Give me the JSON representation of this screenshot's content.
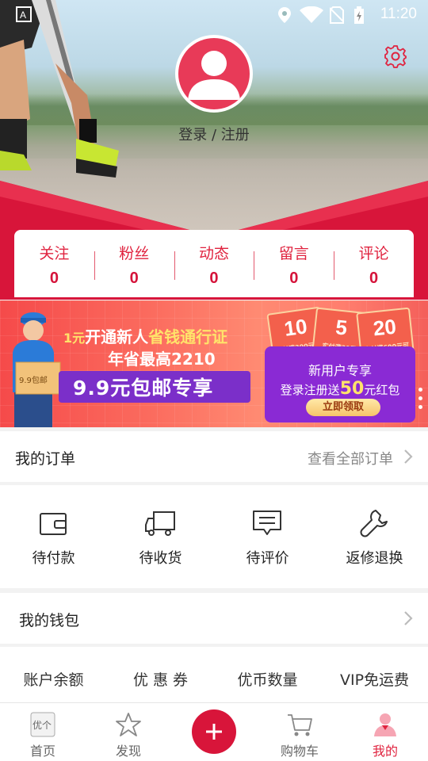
{
  "status_bar": {
    "time": "11:20",
    "icons": [
      "a-icon",
      "location-icon",
      "wifi-icon",
      "no-sim-icon",
      "battery-icon"
    ]
  },
  "profile": {
    "login_text": "登录 / 注册",
    "avatar_icon": "user-avatar-icon",
    "settings_icon": "gear-icon"
  },
  "stats": [
    {
      "label": "关注",
      "value": "0"
    },
    {
      "label": "粉丝",
      "value": "0"
    },
    {
      "label": "动态",
      "value": "0"
    },
    {
      "label": "留言",
      "value": "0"
    },
    {
      "label": "评论",
      "value": "0"
    }
  ],
  "promo": {
    "line1_prefix": "1元",
    "line1_mid": "开通新人",
    "line1_highlight": "省钱通行证",
    "line2": "年省最高2210",
    "pill": "9.9元包邮专享",
    "box_label": "9.9包邮",
    "vouchers": [
      {
        "amount": "10",
        "caption": "实付满300元可用"
      },
      {
        "amount": "5",
        "caption": "实付满39元"
      },
      {
        "amount": "20",
        "caption": "实付满600元可用"
      }
    ],
    "voucher_title": "新用户专享",
    "voucher_sub_prefix": "登录注册送",
    "voucher_sub_amount": "50",
    "voucher_sub_suffix": "元红包",
    "voucher_button": "立即领取"
  },
  "orders": {
    "title": "我的订单",
    "link": "查看全部订单",
    "items": [
      {
        "label": "待付款",
        "icon": "wallet-icon"
      },
      {
        "label": "待收货",
        "icon": "truck-icon"
      },
      {
        "label": "待评价",
        "icon": "comment-icon"
      },
      {
        "label": "返修退换",
        "icon": "wrench-icon"
      }
    ]
  },
  "wallet": {
    "title": "我的钱包",
    "items": [
      "账户余额",
      "优 惠 券",
      "优币数量",
      "VIP免运费"
    ]
  },
  "bottom_nav": [
    {
      "label": "首页",
      "icon": "home-logo-icon"
    },
    {
      "label": "发现",
      "icon": "star-icon"
    },
    {
      "label": "",
      "icon": "plus-icon"
    },
    {
      "label": "购物车",
      "icon": "cart-icon"
    },
    {
      "label": "我的",
      "icon": "profile-icon"
    }
  ],
  "home_logo_text": "优个",
  "colors": {
    "accent": "#d8153a",
    "stat_text": "#e0233f",
    "promo_pill": "#7b2fc9",
    "voucher_box": "#8a2ad4"
  }
}
